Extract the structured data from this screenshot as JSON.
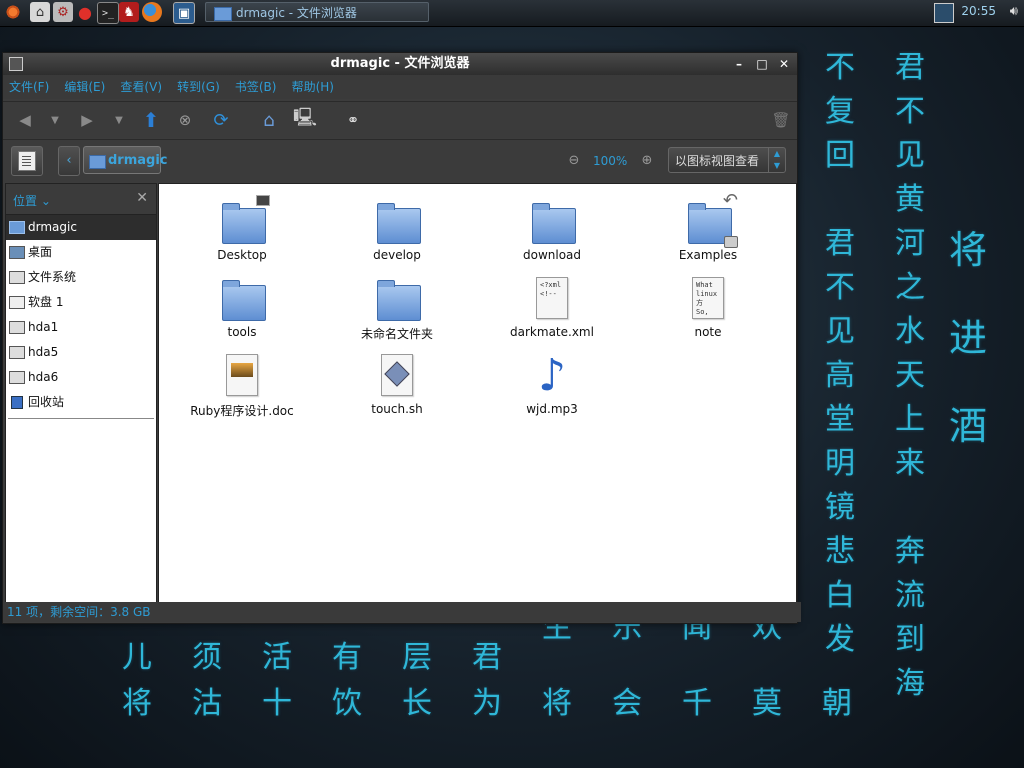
{
  "wallpaper": {
    "col_far_left": [
      "不",
      "复",
      "回",
      "",
      "君",
      "不",
      "见",
      "高",
      "堂",
      "明",
      "镜",
      "悲",
      "白",
      "发"
    ],
    "col_middle": [
      "君",
      "不",
      "见",
      "黄",
      "河",
      "之",
      "水",
      "天",
      "上",
      "来",
      "",
      "奔",
      "流",
      "到",
      "海"
    ],
    "col_title": [
      "将",
      "进",
      "酒"
    ],
    "row_1": [
      "儿",
      "须",
      "活",
      "有",
      "层",
      "君"
    ],
    "row_2": [
      "将",
      "沽",
      "十",
      "饮",
      "长",
      "为",
      "将",
      "会",
      "千",
      "莫",
      "朝"
    ],
    "row_partial": [
      "",
      "",
      "",
      "",
      "",
      "",
      "生",
      "乐",
      "闻",
      "欢"
    ]
  },
  "top_panel": {
    "taskbar_title": "drmagic - 文件浏览器",
    "clock": "20:55"
  },
  "window": {
    "title": "drmagic - 文件浏览器",
    "menus": [
      "文件(F)",
      "编辑(E)",
      "查看(V)",
      "转到(G)",
      "书签(B)",
      "帮助(H)"
    ],
    "location": {
      "path_label": "drmagic",
      "zoom": "100%",
      "view_mode": "以图标视图查看"
    },
    "sidebar": {
      "header": "位置",
      "items": [
        {
          "label": "drmagic",
          "icon": "home-folder-icon"
        },
        {
          "label": "桌面",
          "icon": "desktop-icon"
        },
        {
          "label": "文件系统",
          "icon": "filesystem-drive-icon"
        },
        {
          "label": "软盘 1",
          "icon": "floppy-drive-icon"
        },
        {
          "label": "hda1",
          "icon": "hard-drive-icon"
        },
        {
          "label": "hda5",
          "icon": "hard-drive-icon"
        },
        {
          "label": "hda6",
          "icon": "hard-drive-icon"
        },
        {
          "label": "回收站",
          "icon": "trash-icon"
        }
      ]
    },
    "files": [
      {
        "name": "Desktop",
        "type": "folder",
        "emblem": "desktop"
      },
      {
        "name": "develop",
        "type": "folder"
      },
      {
        "name": "download",
        "type": "folder"
      },
      {
        "name": "Examples",
        "type": "folder",
        "emblem": "symlink-locked"
      },
      {
        "name": "tools",
        "type": "folder"
      },
      {
        "name": "未命名文件夹",
        "type": "folder"
      },
      {
        "name": "darkmate.xml",
        "type": "xml",
        "preview": [
          "<?xml",
          "<!--"
        ]
      },
      {
        "name": "note",
        "type": "text",
        "preview": [
          "What",
          "linux方",
          "So, yo"
        ]
      },
      {
        "name": "Ruby程序设计.doc",
        "type": "doc"
      },
      {
        "name": "touch.sh",
        "type": "script"
      },
      {
        "name": "wjd.mp3",
        "type": "audio"
      }
    ],
    "status": "11 项，剩余空间：3.8 GB"
  }
}
